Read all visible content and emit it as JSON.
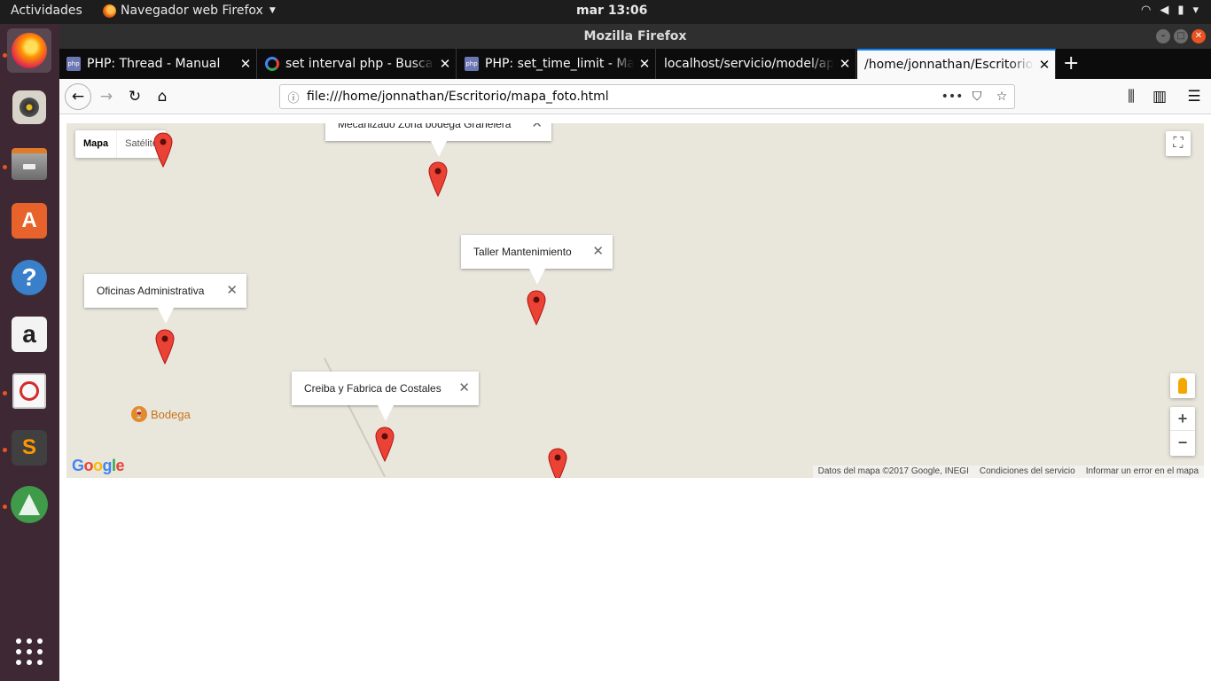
{
  "topbar": {
    "activities": "Actividades",
    "app_menu": "Navegador web Firefox",
    "clock": "mar 13:06",
    "system_icons": [
      "wifi-icon",
      "volume-icon",
      "battery-icon",
      "caret-down-icon"
    ]
  },
  "dock": {
    "items": [
      "firefox",
      "rhythmbox",
      "files",
      "ubuntu-software",
      "help",
      "amazon",
      "pdf-viewer",
      "sublime-text",
      "android-studio",
      "show-applications"
    ]
  },
  "window": {
    "title": "Mozilla Firefox"
  },
  "tabs": [
    {
      "label": "PHP: Thread - Manual",
      "icon": "php-icon",
      "active": false
    },
    {
      "label": "set interval php - Buscar con Google",
      "icon": "google-icon",
      "active": false
    },
    {
      "label": "PHP: set_time_limit - Manual",
      "icon": "php-icon",
      "active": false
    },
    {
      "label": "localhost/servicio/model/api",
      "icon": "",
      "active": false
    },
    {
      "label": "/home/jonnathan/Escritorio/mapa_foto.html",
      "icon": "",
      "active": true
    }
  ],
  "navbar": {
    "url": "file:///home/jonnathan/Escritorio/mapa_foto.html"
  },
  "map": {
    "type_control": {
      "map": "Mapa",
      "satellite": "Satélite"
    },
    "info_windows": [
      {
        "label": "Mecanizado Zona bodega Granelera"
      },
      {
        "label": "Taller Mantenimiento"
      },
      {
        "label": "Oficinas Administrativa"
      },
      {
        "label": "Creiba y Fabrica de Costales"
      }
    ],
    "poi": "Bodega",
    "zoom_in": "+",
    "zoom_out": "−",
    "logo": "Google",
    "attribution": {
      "data": "Datos del mapa ©2017 Google, INEGI",
      "terms": "Condiciones del servicio",
      "report": "Informar un error en el mapa"
    },
    "colors": {
      "marker": "#ea4335",
      "map_bg": "#e9e6dc"
    }
  }
}
